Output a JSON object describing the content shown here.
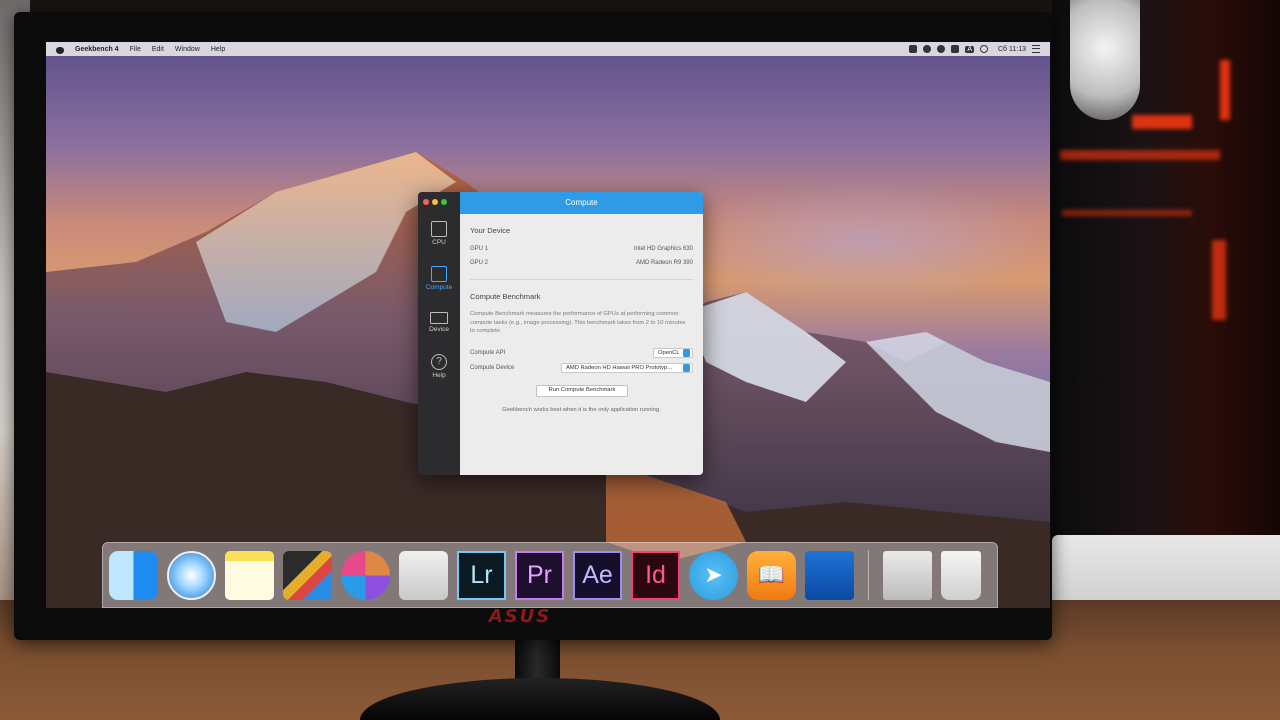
{
  "menubar": {
    "app_name": "Geekbench 4",
    "items": [
      "File",
      "Edit",
      "Window",
      "Help"
    ],
    "clock": "Сб 11:13",
    "status_icons": [
      "camera-icon",
      "record-icon",
      "sync-icon",
      "alert-icon",
      "keyboard-layout-icon",
      "search-icon",
      "notifications-icon"
    ],
    "status_letter": "A"
  },
  "window": {
    "title": "Compute",
    "sidebar": [
      {
        "label": "CPU",
        "icon": "cpu-icon",
        "active": false
      },
      {
        "label": "Compute",
        "icon": "compute-icon",
        "active": true
      },
      {
        "label": "Device",
        "icon": "device-icon",
        "active": false
      },
      {
        "label": "Help",
        "icon": "help-icon",
        "active": false
      }
    ],
    "your_device": {
      "heading": "Your Device",
      "gpu1_label": "GPU 1",
      "gpu1_value": "Intel HD Graphics 630",
      "gpu2_label": "GPU 2",
      "gpu2_value": "AMD Radeon R9 390"
    },
    "benchmark": {
      "heading": "Compute Benchmark",
      "description": "Compute Benchmark measures the performance of GPUs at performing common compute tasks (e.g., image processing). This benchmark takes from 2 to 10 minutes to complete.",
      "api_label": "Compute API",
      "api_value": "OpenCL",
      "device_label": "Compute Device",
      "device_value": "AMD Radeon HD Hawaii PRO Prototyp...",
      "run_button": "Run Compute Benchmark",
      "footnote": "Geekbench works best when it is the only application running."
    }
  },
  "dock": {
    "apps": [
      "finder-icon",
      "safari-icon",
      "notes-icon",
      "final-cut-pro-icon",
      "motion-icon",
      "compressor-icon",
      "lightroom-icon",
      "premiere-icon",
      "after-effects-icon",
      "indesign-icon",
      "telegram-icon",
      "ibooks-icon",
      "keynote-icon",
      "downloads-stack-icon",
      "trash-icon"
    ],
    "labels": {
      "lr": "Lr",
      "pr": "Pr",
      "ae": "Ae",
      "id": "Id"
    }
  },
  "monitor": {
    "brand": "ASUS"
  },
  "colors": {
    "accent": "#2f9be6",
    "sidebar_bg": "#2c2c2e",
    "active_item": "#4aa8ff"
  }
}
